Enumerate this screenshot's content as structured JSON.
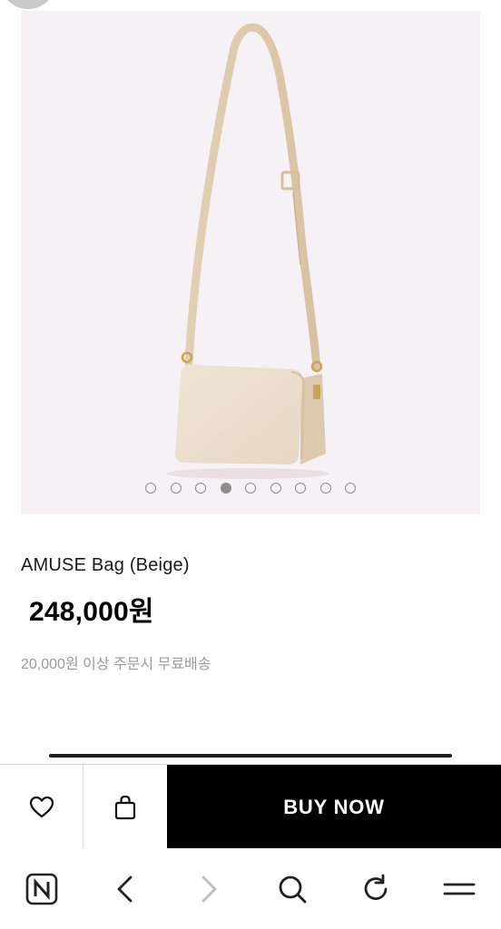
{
  "product": {
    "name": "AMUSE Bag (Beige)",
    "price": "248,000원",
    "shipping_note": "20,000원 이상 주문시 무료배송",
    "image_alt": "AMUSE Bag beige shoulder bag",
    "carousel": {
      "total": 9,
      "active_index": 3
    }
  },
  "actions": {
    "wishlist_icon": "heart-icon",
    "cart_icon": "shopping-bag-icon",
    "buy_label": "BUY NOW"
  },
  "browser_nav": {
    "items": [
      "naver-home-icon",
      "back-icon",
      "forward-icon",
      "search-icon",
      "refresh-icon",
      "menu-icon"
    ]
  },
  "colors": {
    "image_bg": "#f6f1f4",
    "bag": "#ede1d0",
    "buy_bg": "#000000",
    "muted_text": "#9a9a9a"
  }
}
